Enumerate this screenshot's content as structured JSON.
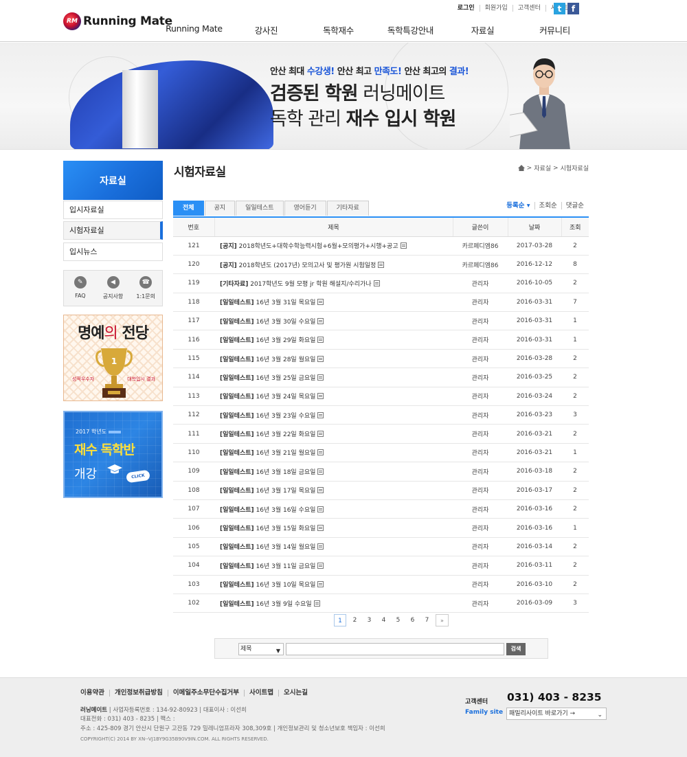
{
  "header": {
    "logo_mark": "RM",
    "logo_text": "Running Mate",
    "util_links": [
      "로그인",
      "회원가입",
      "고객센터",
      "사이트맵"
    ],
    "sns": [
      {
        "name": "twitter",
        "glyph": "t",
        "color": "#2aa3e0"
      },
      {
        "name": "facebook",
        "glyph": "f",
        "color": "#3b5998"
      }
    ],
    "nav": [
      "Running Mate",
      "강사진",
      "독학재수",
      "독학특강안내",
      "자료실",
      "커뮤니티"
    ]
  },
  "banner": {
    "line1_a": "안산 최대 ",
    "line1_b": "수강생!",
    "line1_c": " 안산 최고 ",
    "line1_d": "만족도!",
    "line1_e": " 안산 최고의 ",
    "line1_f": "결과!",
    "line2_bold": "검증된 학원",
    "line2_rest": " 러닝메이트",
    "line3_a": "독학 관리 ",
    "line3_bold": "재수 입시 학원"
  },
  "sidebar": {
    "title": "자료실",
    "items": [
      {
        "label": "입시자료실",
        "active": false
      },
      {
        "label": "시험자료실",
        "active": true
      },
      {
        "label": "입시뉴스",
        "active": false
      }
    ],
    "quick": [
      {
        "label": "FAQ",
        "icon": "pencil-icon"
      },
      {
        "label": "공지사항",
        "icon": "megaphone-icon"
      },
      {
        "label": "1:1문의",
        "icon": "phone-icon"
      }
    ],
    "honor": {
      "title_a": "명예",
      "title_o": "의",
      "title_b": " 전당",
      "rank": "1",
      "left": "성적우수자",
      "right": "대학입시 결과"
    },
    "promo": {
      "year": "2017 학년도",
      "main": "재수 독학반",
      "sub": "개강",
      "click": "CLICK"
    }
  },
  "content": {
    "title": "시험자료실",
    "breadcrumb": [
      "자료실",
      "시험자료실"
    ],
    "tabs": [
      "전체",
      "공지",
      "일일테스트",
      "영어듣기",
      "기타자료"
    ],
    "active_tab": "전체",
    "sort": [
      "등록순 ▾",
      "조회순",
      "댓글순"
    ],
    "columns": [
      "번호",
      "제목",
      "글쓴이",
      "날짜",
      "조회"
    ],
    "rows": [
      {
        "no": "121",
        "cat": "[공지]",
        "title": "2018학년도+대학수학능력시험+6월+모의평가+시행+공고",
        "author": "카르페디엠86",
        "date": "2017-03-28",
        "views": "2"
      },
      {
        "no": "120",
        "cat": "[공지]",
        "title": "2018학년도 (2017년) 모의고사 및 평가원 시험일정",
        "author": "카르페디엠86",
        "date": "2016-12-12",
        "views": "8"
      },
      {
        "no": "119",
        "cat": "[기타자료]",
        "title": "2017학년도 9월 모평 jr 학원 해설지/수리가나",
        "author": "관리자",
        "date": "2016-10-05",
        "views": "2"
      },
      {
        "no": "118",
        "cat": "[일일테스트]",
        "title": "16년 3월 31일 목요일",
        "author": "관리자",
        "date": "2016-03-31",
        "views": "7"
      },
      {
        "no": "117",
        "cat": "[일일테스트]",
        "title": "16년 3월 30일 수요일",
        "author": "관리자",
        "date": "2016-03-31",
        "views": "1"
      },
      {
        "no": "116",
        "cat": "[일일테스트]",
        "title": "16년 3월 29일 화요일",
        "author": "관리자",
        "date": "2016-03-31",
        "views": "1"
      },
      {
        "no": "115",
        "cat": "[일일테스트]",
        "title": "16년 3월 28일 월요일",
        "author": "관리자",
        "date": "2016-03-28",
        "views": "2"
      },
      {
        "no": "114",
        "cat": "[일일테스트]",
        "title": "16년 3월 25일 금요일",
        "author": "관리자",
        "date": "2016-03-25",
        "views": "2"
      },
      {
        "no": "113",
        "cat": "[일일테스트]",
        "title": "16년 3월 24일 목요일",
        "author": "관리자",
        "date": "2016-03-24",
        "views": "2"
      },
      {
        "no": "112",
        "cat": "[일일테스트]",
        "title": "16년 3월 23일 수요일",
        "author": "관리자",
        "date": "2016-03-23",
        "views": "3"
      },
      {
        "no": "111",
        "cat": "[일일테스트]",
        "title": "16년 3월 22일 화요일",
        "author": "관리자",
        "date": "2016-03-21",
        "views": "2"
      },
      {
        "no": "110",
        "cat": "[일일테스트]",
        "title": "16년 3월 21일 월요일",
        "author": "관리자",
        "date": "2016-03-21",
        "views": "1"
      },
      {
        "no": "109",
        "cat": "[일일테스트]",
        "title": "16년 3월 18일 금요일",
        "author": "관리자",
        "date": "2016-03-18",
        "views": "2"
      },
      {
        "no": "108",
        "cat": "[일일테스트]",
        "title": "16년 3월 17일 목요일",
        "author": "관리자",
        "date": "2016-03-17",
        "views": "2"
      },
      {
        "no": "107",
        "cat": "[일일테스트]",
        "title": "16년 3월 16일 수요일",
        "author": "관리자",
        "date": "2016-03-16",
        "views": "2"
      },
      {
        "no": "106",
        "cat": "[일일테스트]",
        "title": "16년 3월 15일 화요일",
        "author": "관리자",
        "date": "2016-03-16",
        "views": "1"
      },
      {
        "no": "105",
        "cat": "[일일테스트]",
        "title": "16년 3월 14일 월요일",
        "author": "관리자",
        "date": "2016-03-14",
        "views": "2"
      },
      {
        "no": "104",
        "cat": "[일일테스트]",
        "title": "16년 3월 11일 금요일",
        "author": "관리자",
        "date": "2016-03-11",
        "views": "2"
      },
      {
        "no": "103",
        "cat": "[일일테스트]",
        "title": "16년 3월 10일 목요일",
        "author": "관리자",
        "date": "2016-03-10",
        "views": "2"
      },
      {
        "no": "102",
        "cat": "[일일테스트]",
        "title": "16년 3월 9일 수요일",
        "author": "관리자",
        "date": "2016-03-09",
        "views": "3"
      }
    ],
    "pages": [
      "1",
      "2",
      "3",
      "4",
      "5",
      "6",
      "7"
    ],
    "current_page": "1",
    "next_label": "»",
    "search": {
      "field": "제목",
      "button": "검색"
    }
  },
  "footer": {
    "links": [
      "이용약관",
      "개인정보취급방침",
      "이메일주소무단수집거부",
      "사이트맵",
      "오시는길"
    ],
    "line1_name": "러닝메이트",
    "line1_rest": " | 사업자등록번호 : 134-92-80923 | 대표이사 : 이선희",
    "line2": "대표전화 : 031) 403 - 8235 | 팩스 :",
    "line3": "주소 : 425-809 경기 안산시 단원구 고잔동 729 밀레니엄프라자 308,309호 | 개인정보관리 및 청소년보호 책임자 : 이선희",
    "copyright": "COPYRIGHT(C) 2014 BY XN--VJ1BY9G35B90V9IN.COM. ALL RIGHTS RESERVED.",
    "cs_label": "고객센터",
    "cs_phone": "031) 403 - 8235",
    "family_label": "Family site",
    "family_select": "패밀리사이트 바로가기 →"
  }
}
